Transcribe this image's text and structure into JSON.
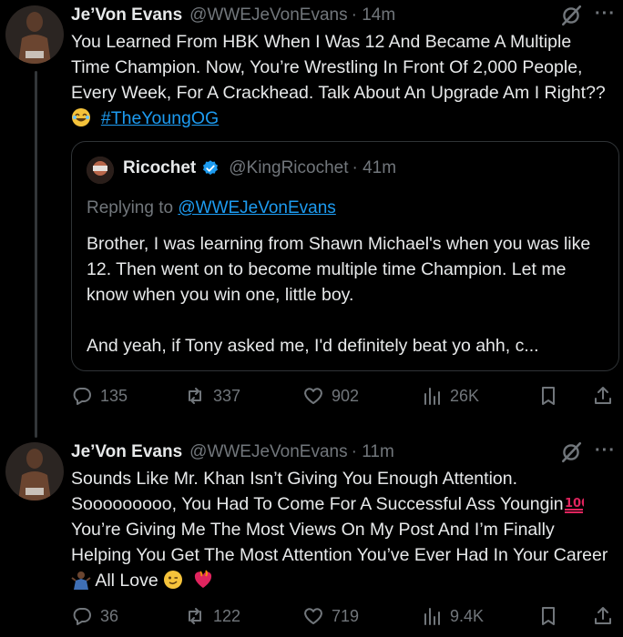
{
  "tweets": [
    {
      "author": {
        "name": "Je’Von Evans",
        "handle": "@WWEJeVonEvans"
      },
      "time": "· 14m",
      "icon": "grok-icon",
      "more": "···",
      "text": "You Learned From HBK When I Was 12 And Became A Multiple Time Champion. Now, You’re Wrestling In Front Of 2,000 People, Every Week, For A Crackhead. Talk About An Upgrade Am I Right??",
      "hashtag": "#TheYoungOG",
      "quote": {
        "author": {
          "name": "Ricochet",
          "handle": "@KingRicochet"
        },
        "time": "· 41m",
        "reply_prefix": "Replying to",
        "reply_to": "@WWEJeVonEvans",
        "text": "Brother, I was learning from Shawn Michael's when you was like 12. Then went on to become multiple time Champion. Let me know when you win one, little boy.",
        "text2": "And yeah, if Tony asked me, I'd definitely beat yo ahh, c..."
      },
      "stats": {
        "replies": "135",
        "reposts": "337",
        "likes": "902",
        "views": "26K"
      }
    },
    {
      "author": {
        "name": "Je’Von Evans",
        "handle": "@WWEJeVonEvans"
      },
      "time": "· 11m",
      "more": "···",
      "text_part1": "Sounds Like Mr. Khan Isn’t Giving You Enough Attention. Sooooooooo, You Had To Come For A Successful Ass Youngin",
      "text_part2": " You’re Giving Me The Most Views On My Post And I’m Finally Helping You Get The Most Attention You’ve Ever Had In Your Career",
      "text_part3": " All Love",
      "stats": {
        "replies": "36",
        "reposts": "122",
        "likes": "719",
        "views": "9.4K"
      }
    }
  ],
  "colors": {
    "background": "#000000",
    "text": "#e7e9ea",
    "muted": "#71767b",
    "link": "#1d9bf0",
    "border": "#2f3336"
  }
}
